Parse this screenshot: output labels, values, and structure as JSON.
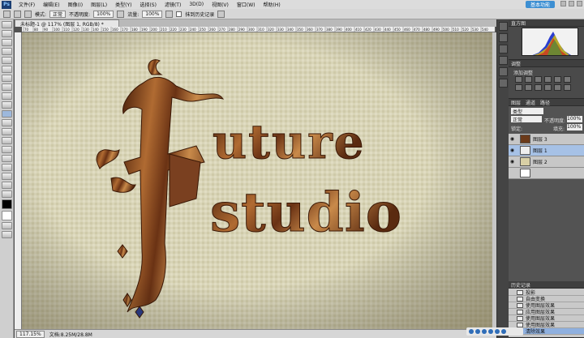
{
  "app": {
    "logo": "Ps",
    "menus": [
      "文件(F)",
      "编辑(E)",
      "图像(I)",
      "图层(L)",
      "类型(Y)",
      "选择(S)",
      "滤镜(T)",
      "3D(D)",
      "视图(V)",
      "窗口(W)",
      "帮助(H)"
    ],
    "workspace_button": "基本功能"
  },
  "options_bar": {
    "mode_label": "模式:",
    "mode_value": "正常",
    "opacity_label": "不透明度:",
    "opacity_value": "100%",
    "flow_label": "流量:",
    "flow_value": "100%",
    "history_label": "抹到历史记录"
  },
  "document": {
    "tab_title": "未标题-1 @ 117% (图层 1, RGB/8) *",
    "ruler_ticks": [
      "70",
      "80",
      "90",
      "100",
      "110",
      "120",
      "130",
      "140",
      "150",
      "160",
      "170",
      "180",
      "190",
      "200",
      "210",
      "220",
      "230",
      "240",
      "250",
      "260",
      "270",
      "280",
      "290",
      "300",
      "310",
      "320",
      "330",
      "340",
      "350",
      "360",
      "370",
      "380",
      "390",
      "400",
      "410",
      "420",
      "430",
      "440",
      "450",
      "460",
      "470",
      "480",
      "490",
      "500",
      "510",
      "520",
      "530",
      "540"
    ],
    "zoom": "117.15%",
    "doc_info": "文档:8.25M/28.8M",
    "artwork": {
      "first_word": "uture",
      "second_word": "studio",
      "big_letter": "F"
    }
  },
  "colors": {
    "canvas_bg": "#d8d4b7",
    "wood_dark": "#5a2a10",
    "wood_light": "#c98a4a",
    "selected": "#a6c1e6"
  },
  "panels": {
    "histogram_title": "直方图",
    "adjustments_title": "调整",
    "adjustments_sub": "添加调整",
    "layers_tabs": [
      "图层",
      "通道",
      "路径"
    ],
    "layers_kind": "类型",
    "layers_blend": "正常",
    "layers_opacity_label": "不透明度:",
    "layers_opacity": "100%",
    "layers_lock_label": "锁定:",
    "layers_fill_label": "填充:",
    "layers_fill": "100%",
    "layers": [
      {
        "name": "图层 3",
        "selected": false
      },
      {
        "name": "图层 1",
        "selected": true
      },
      {
        "name": "图层 2",
        "selected": false
      },
      {
        "name": "",
        "selected": false
      }
    ],
    "history_title": "历史记录",
    "history": [
      {
        "name": "投影",
        "selected": false
      },
      {
        "name": "自由变换",
        "selected": false
      },
      {
        "name": "使用图层效果",
        "selected": false
      },
      {
        "name": "应用图层效果",
        "selected": false
      },
      {
        "name": "使用图层效果",
        "selected": false
      },
      {
        "name": "使用图层效果",
        "selected": false
      },
      {
        "name": "清除效果",
        "selected": true
      }
    ]
  }
}
